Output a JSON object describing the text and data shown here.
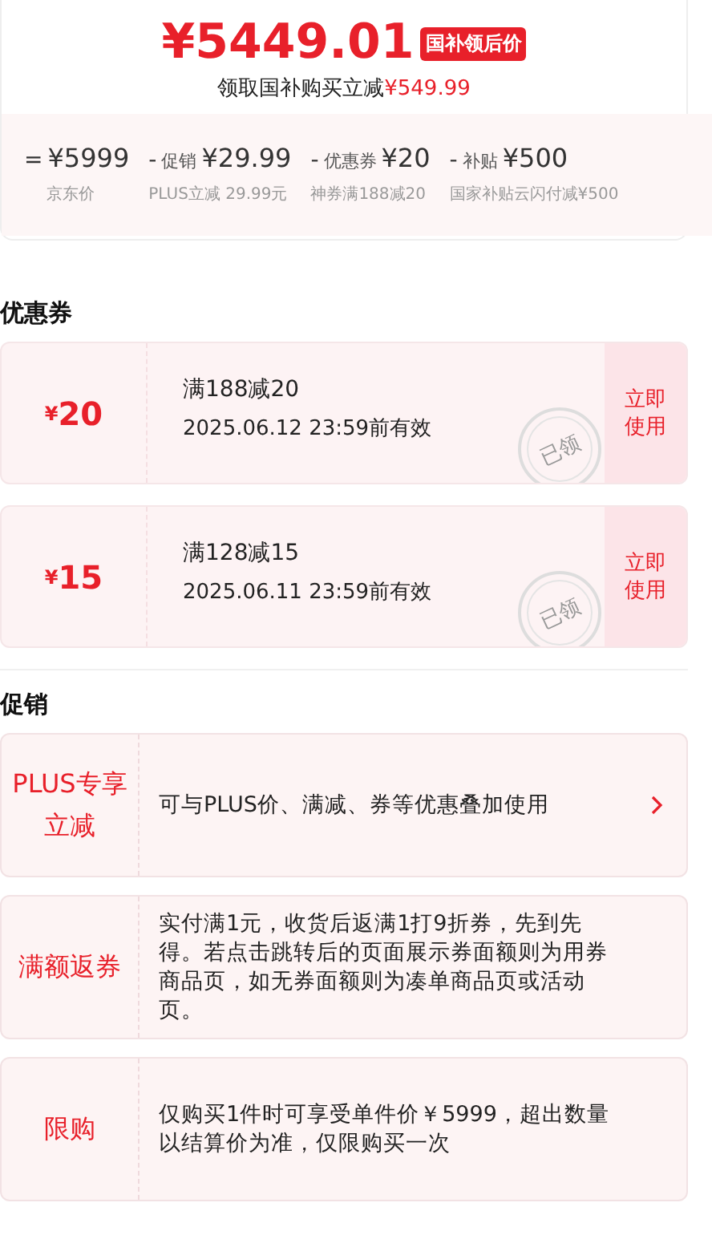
{
  "price_header": {
    "price": "¥5449.01",
    "badge": "国补领后价",
    "subtitle": "领取国补购买立减",
    "subtitle_amount": "¥549.99"
  },
  "breakdown": [
    {
      "operator": "=",
      "amount": "¥5999",
      "note": "京东价"
    },
    {
      "operator": "-",
      "name": "促销",
      "amount": "¥29.99",
      "note": "PLUS立减 29.99元"
    },
    {
      "operator": "-",
      "name": "优惠券",
      "amount": "¥20",
      "note": "神券满188减20"
    },
    {
      "operator": "-",
      "name": "补贴",
      "amount": "¥500",
      "note": "国家补贴云闪付减¥500"
    }
  ],
  "coupons_section": {
    "title": "优惠券",
    "coupons": [
      {
        "currency": "¥",
        "amount": "20",
        "condition": "满188减20",
        "validity": "2025.06.12 23:59前有效",
        "stamp": "已领",
        "action": "立即使用"
      },
      {
        "currency": "¥",
        "amount": "15",
        "condition": "满128减15",
        "validity": "2025.06.11 23:59前有效",
        "stamp": "已领",
        "action": "立即使用"
      }
    ]
  },
  "promotions_section": {
    "title": "促销",
    "items": [
      {
        "kind": "link",
        "label": "PLUS专享立减",
        "description": "可与PLUS价、满减、券等优惠叠加使用"
      },
      {
        "kind": "info",
        "label": "满额返券",
        "description": "实付满1元，收货后返满1打9折券，先到先得。若点击跳转后的页面展示券面额则为用券商品页，如无券面额则为凑单商品页或活动页。"
      },
      {
        "kind": "info",
        "label": "限购",
        "description": "仅购买1件时可享受单件价￥5999，超出数量以结算价为准，仅限购买一次"
      }
    ]
  }
}
